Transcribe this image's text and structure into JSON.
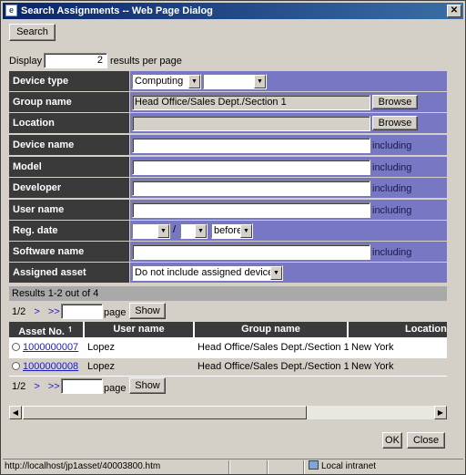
{
  "window": {
    "title": "Search Assignments -- Web Page Dialog",
    "close_glyph": "✕"
  },
  "search_button": "Search",
  "display": {
    "label": "Display",
    "value": "2",
    "suffix": "results per page"
  },
  "form": {
    "device_type": {
      "label": "Device type",
      "value": "Computing",
      "value2": ""
    },
    "group_name": {
      "label": "Group name",
      "value": "Head Office/Sales Dept./Section 1",
      "browse": "Browse"
    },
    "location": {
      "label": "Location",
      "value": "",
      "browse": "Browse"
    },
    "device_name": {
      "label": "Device name",
      "value": "",
      "suffix": "including"
    },
    "model": {
      "label": "Model",
      "value": "",
      "suffix": "including"
    },
    "developer": {
      "label": "Developer",
      "value": "",
      "suffix": "including"
    },
    "user_name": {
      "label": "User name",
      "value": "",
      "suffix": "including"
    },
    "reg_date": {
      "label": "Reg. date",
      "sep": "/",
      "condition": "before"
    },
    "software_name": {
      "label": "Software name",
      "value": "",
      "suffix": "including"
    },
    "assigned_asset": {
      "label": "Assigned asset",
      "value": "Do not include assigned devices"
    }
  },
  "results": {
    "summary": "Results 1-2 out of 4",
    "page_info": "1/2",
    "next": ">",
    "last": ">>",
    "page_label": "page",
    "show": "Show"
  },
  "table": {
    "columns": [
      "Asset No.",
      "User name",
      "Group name",
      "Location"
    ],
    "sort_indicator": "↿",
    "rows": [
      {
        "asset_no": "1000000007",
        "user": "Lopez",
        "group": "Head Office/Sales Dept./Section 1",
        "location": "New York"
      },
      {
        "asset_no": "1000000008",
        "user": "Lopez",
        "group": "Head Office/Sales Dept./Section 1",
        "location": "New York"
      }
    ]
  },
  "dialog_buttons": {
    "ok": "OK",
    "close": "Close"
  },
  "status": {
    "url": "http://localhost/jp1asset/40003800.htm",
    "zone": "Local intranet"
  }
}
